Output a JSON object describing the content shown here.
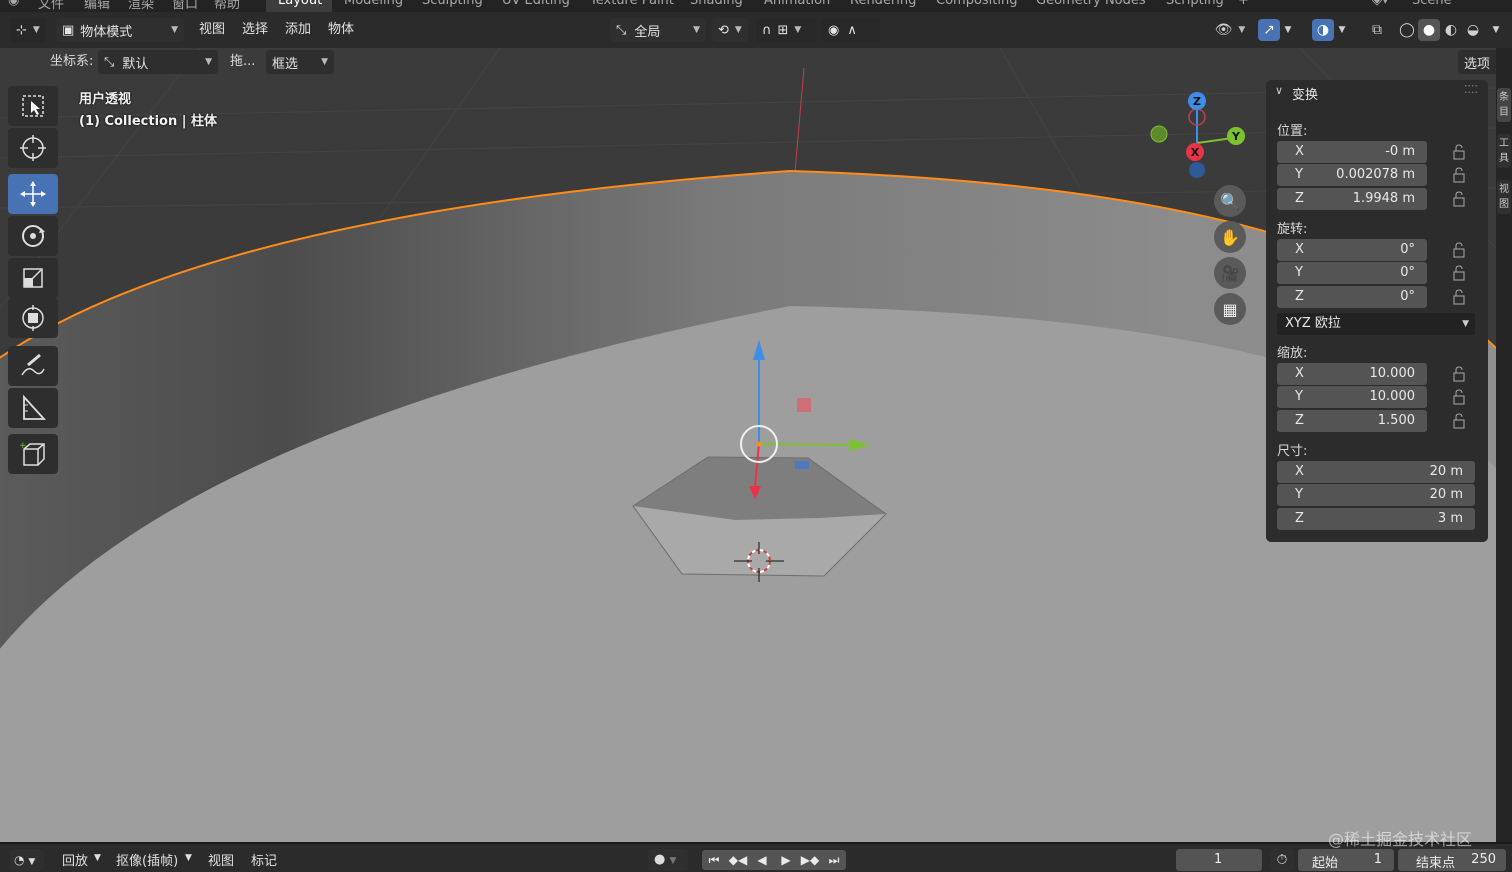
{
  "workspace_tabs": [
    "文件",
    "编辑",
    "渲染",
    "窗口",
    "帮助",
    "Layout",
    "Modeling",
    "Sculpting",
    "UV Editing",
    "Texture Paint",
    "Shading",
    "Animation",
    "Rendering",
    "Compositing",
    "Geometry Nodes",
    "Scripting",
    "+"
  ],
  "active_tab": "Layout",
  "scene_name": "Scene",
  "header": {
    "mode": "物体模式",
    "menus": [
      "视图",
      "选择",
      "添加",
      "物体"
    ],
    "orientation": "全局",
    "options_label": "选项"
  },
  "subheader": {
    "coord_label": "坐标系:",
    "coord_value": "默认",
    "drag_label": "拖...",
    "drag_value": "框选"
  },
  "viewport": {
    "view_name": "用户透视",
    "collection": "(1) Collection | 柱体"
  },
  "gizmo_axes": [
    "Z",
    "Y",
    "X"
  ],
  "npanel": {
    "title": "变换",
    "location_label": "位置:",
    "location": [
      {
        "axis": "X",
        "value": "-0 m"
      },
      {
        "axis": "Y",
        "value": "0.002078 m"
      },
      {
        "axis": "Z",
        "value": "1.9948 m"
      }
    ],
    "rotation_label": "旋转:",
    "rotation": [
      {
        "axis": "X",
        "value": "0°"
      },
      {
        "axis": "Y",
        "value": "0°"
      },
      {
        "axis": "Z",
        "value": "0°"
      }
    ],
    "rotation_mode": "XYZ 欧拉",
    "scale_label": "缩放:",
    "scale": [
      {
        "axis": "X",
        "value": "10.000"
      },
      {
        "axis": "Y",
        "value": "10.000"
      },
      {
        "axis": "Z",
        "value": "1.500"
      }
    ],
    "dimensions_label": "尺寸:",
    "dimensions": [
      {
        "axis": "X",
        "value": "20 m"
      },
      {
        "axis": "Y",
        "value": "20 m"
      },
      {
        "axis": "Z",
        "value": "3 m"
      }
    ]
  },
  "side_tabs": [
    "条目",
    "工具",
    "视图"
  ],
  "timeline": {
    "menus": [
      "回放",
      "抠像(插帧)",
      "视图",
      "标记"
    ],
    "current_frame": "1",
    "start_label": "起始",
    "start_value": "1",
    "end_label": "结束点",
    "end_value": "250"
  },
  "watermark": "@稀土掘金技术社区",
  "colors": {
    "accent": "#4772b3",
    "selection_outline": "#ff8c1a",
    "axis_x": "#e8344a",
    "axis_y": "#7cc22e",
    "axis_z": "#3c8ee8"
  }
}
